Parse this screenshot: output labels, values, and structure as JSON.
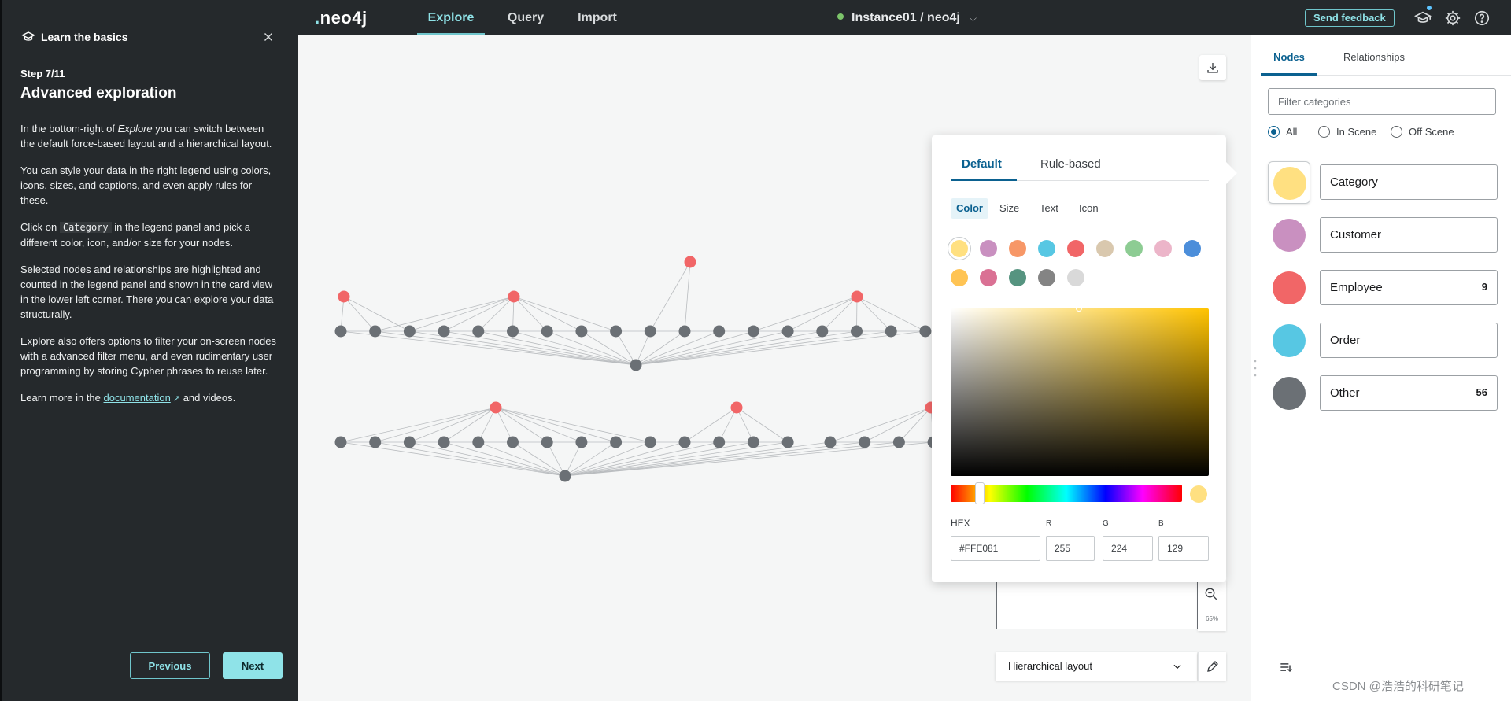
{
  "app": {
    "logo": "neo4j",
    "nav_tabs": [
      "Explore",
      "Query",
      "Import"
    ],
    "active_tab": "Explore",
    "instance": "Instance01 / neo4j",
    "feedback_label": "Send feedback"
  },
  "guide": {
    "header": "Learn the basics",
    "step": "Step 7/11",
    "title": "Advanced exploration",
    "p1_a": "In the bottom-right of ",
    "p1_em": "Explore",
    "p1_b": " you can switch between the default force-based layout and a hierarchical layout.",
    "p2": "You can style your data in the right legend using colors, icons, sizes, and captions, and even apply rules for these.",
    "p3_a": "Click on ",
    "p3_code": "Category",
    "p3_b": " in the legend panel and pick a different color, icon, and/or size for your nodes.",
    "p4": "Selected nodes and relationships are highlighted and counted in the legend panel and shown in the card view in the lower left corner. There you can explore your data structurally.",
    "p5": "Explore also offers options to filter your on-screen nodes with a advanced filter menu, and even rudimentary user programming by storing Cypher phrases to reuse later.",
    "p6_a": "Learn more in the ",
    "p6_link": "documentation",
    "p6_b": " and videos.",
    "prev_label": "Previous",
    "next_label": "Next"
  },
  "canvas": {
    "layout_label": "Hierarchical layout",
    "zoom_pct": "65%"
  },
  "style_popover": {
    "tabs": [
      "Default",
      "Rule-based"
    ],
    "active_tab": "Default",
    "subtabs": [
      "Color",
      "Size",
      "Text",
      "Icon"
    ],
    "active_subtab": "Color",
    "swatches": [
      "#ffe081",
      "#c990c0",
      "#f79767",
      "#57c7e3",
      "#f16667",
      "#d9c8ae",
      "#8dcc93",
      "#ecb5c9",
      "#4c8eda",
      "#ffc454",
      "#da7194",
      "#569480",
      "#848484",
      "#d9d9d9"
    ],
    "selected_swatch": 0,
    "hex_label": "HEX",
    "hex_value": "#FFE081",
    "r_label": "R",
    "r_value": "255",
    "g_label": "G",
    "g_value": "224",
    "b_label": "B",
    "b_value": "129",
    "current_color": "#ffe081"
  },
  "legend": {
    "tabs": [
      "Nodes",
      "Relationships"
    ],
    "active_tab": "Nodes",
    "filter_placeholder": "Filter categories",
    "radios": [
      "All",
      "In Scene",
      "Off Scene"
    ],
    "selected_radio": "All",
    "categories": [
      {
        "name": "Category",
        "color": "#ffe081",
        "count": ""
      },
      {
        "name": "Customer",
        "color": "#c990c0",
        "count": ""
      },
      {
        "name": "Employee",
        "color": "#f16667",
        "count": "9"
      },
      {
        "name": "Order",
        "color": "#57c7e3",
        "count": ""
      },
      {
        "name": "Other",
        "color": "#6b7075",
        "count": "56"
      }
    ]
  },
  "graph_colors": {
    "employee_node": "#f16667",
    "other_node": "#6b7075",
    "edge": "#b9bcbf"
  },
  "watermark": "CSDN @浩浩的科研笔记"
}
